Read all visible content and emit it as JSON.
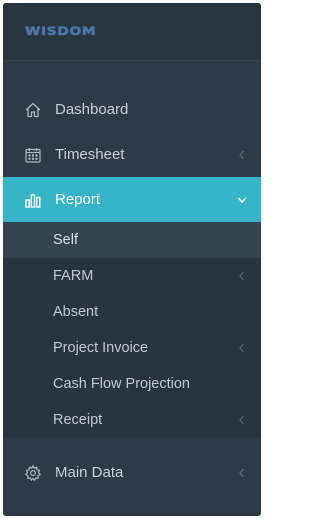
{
  "brand": {
    "logo_text": "WISDOM"
  },
  "menu": {
    "items": [
      {
        "label": "Dashboard",
        "icon": "home-icon",
        "has_children": false
      },
      {
        "label": "Timesheet",
        "icon": "calendar-icon",
        "has_children": true
      },
      {
        "label": "Report",
        "icon": "bar-chart-icon",
        "has_children": true,
        "expanded": true
      }
    ],
    "report_submenu": [
      {
        "label": "Self",
        "has_children": false,
        "current": true
      },
      {
        "label": "FARM",
        "has_children": true
      },
      {
        "label": "Absent",
        "has_children": false
      },
      {
        "label": "Project Invoice",
        "has_children": true
      },
      {
        "label": "Cash Flow Projection",
        "has_children": false
      },
      {
        "label": "Receipt",
        "has_children": true
      }
    ],
    "bottom_items": [
      {
        "label": "Main Data",
        "icon": "gear-icon",
        "has_children": true
      }
    ]
  },
  "colors": {
    "sidebar_bg": "#2c3b47",
    "active_bg": "#36b5c9",
    "submenu_bg": "#27353f",
    "text": "#c7d0d6",
    "logo": "#4a78b0"
  }
}
